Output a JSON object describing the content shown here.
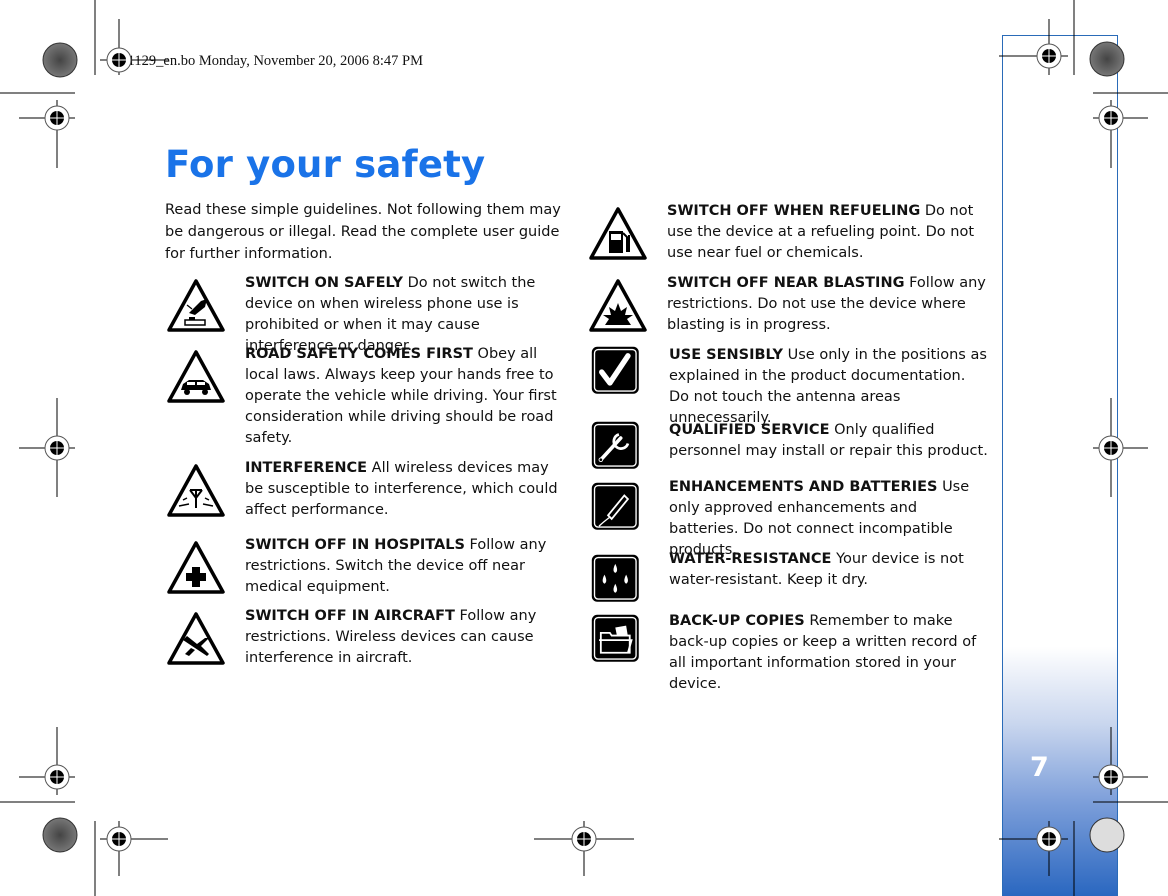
{
  "header_stamp": "R1129_en.bo  Monday, November 20, 2006  8:47 PM",
  "page": {
    "title": "For your safety",
    "intro": "Read these simple guidelines. Not following them may be dangerous or illegal. Read the complete user guide for further information.",
    "page_number": "7",
    "accent_color": "#1a73e8",
    "tab_color": "#2a67c0"
  },
  "left_items": [
    {
      "icon": "switch-on-hand-icon",
      "heading": "SWITCH ON SAFELY",
      "body": "Do not switch the device on when wireless phone use is prohibited or when it may cause interference or danger."
    },
    {
      "icon": "car-icon",
      "heading": "ROAD SAFETY COMES FIRST",
      "body": "Obey all local laws. Always keep your hands free to operate the vehicle while driving. Your first consideration while driving should be road safety."
    },
    {
      "icon": "interference-antenna-icon",
      "heading": "INTERFERENCE",
      "body": "All wireless devices may be susceptible to interference, which could affect performance."
    },
    {
      "icon": "hospital-cross-icon",
      "heading": "SWITCH OFF IN HOSPITALS",
      "body": "Follow any restrictions. Switch the device off near medical equipment."
    },
    {
      "icon": "airplane-icon",
      "heading": "SWITCH OFF IN AIRCRAFT",
      "body": "Follow any restrictions. Wireless devices can cause interference in aircraft."
    }
  ],
  "right_items": [
    {
      "icon": "fuel-pump-icon",
      "heading": "SWITCH OFF WHEN REFUELING",
      "body": "Do not use the device at a refueling point. Do not use near fuel or chemicals."
    },
    {
      "icon": "explosion-icon",
      "heading": "SWITCH OFF NEAR BLASTING",
      "body": "Follow any restrictions. Do not use the device where blasting is in progress."
    },
    {
      "icon": "checkmark-icon",
      "heading": "USE SENSIBLY",
      "body": "Use only in the positions as explained in the product documentation. Do not touch the antenna areas unnecessarily."
    },
    {
      "icon": "wrench-icon",
      "heading": "QUALIFIED SERVICE",
      "body": "Only qualified personnel may install or repair this product."
    },
    {
      "icon": "enhancement-cable-icon",
      "heading": "ENHANCEMENTS AND BATTERIES",
      "body": "Use only approved enhancements and batteries. Do not connect incompatible products."
    },
    {
      "icon": "water-drops-icon",
      "heading": "WATER-RESISTANCE",
      "body": "Your device is not water-resistant. Keep it dry."
    },
    {
      "icon": "folder-icon",
      "heading": "BACK-UP COPIES",
      "body": "Remember to make back-up copies or keep a written record of all important information stored in your device."
    }
  ]
}
